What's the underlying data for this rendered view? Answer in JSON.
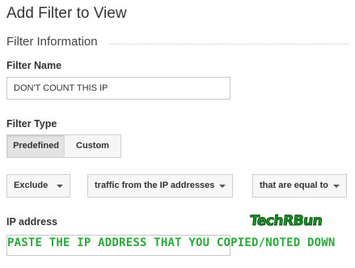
{
  "page": {
    "title": "Add Filter to View"
  },
  "section": {
    "title": "Filter Information"
  },
  "filter_name": {
    "label": "Filter Name",
    "value": "DON'T COUNT THIS IP"
  },
  "filter_type": {
    "label": "Filter Type",
    "options": [
      "Predefined",
      "Custom"
    ],
    "selected": "Predefined"
  },
  "dropdowns": {
    "action": "Exclude",
    "source": "traffic from the IP addresses",
    "condition": "that are equal to"
  },
  "ip_address": {
    "label": "IP address",
    "value": ""
  },
  "annotation": {
    "text": "PASTE THE IP ADDRESS THAT YOU COPIED/NOTED DOWN",
    "color": "#2aaa3a"
  },
  "watermark": {
    "text": "TechRBun"
  }
}
